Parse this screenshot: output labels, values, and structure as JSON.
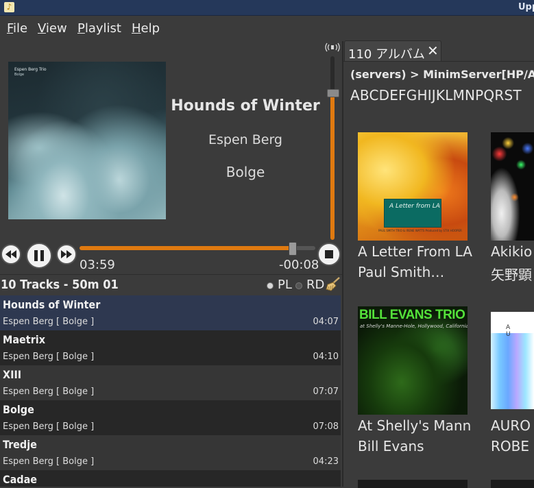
{
  "window": {
    "title": "Upp"
  },
  "menu": [
    "File",
    "View",
    "Playlist",
    "Help"
  ],
  "now_playing": {
    "title": "Hounds of Winter",
    "artist": "Espen Berg",
    "album": "Bolge",
    "cover_artist": "Espen Berg Trio",
    "cover_album": "Bolge",
    "elapsed": "03:59",
    "remaining": "-00:08",
    "progress_fraction": 0.95,
    "volume_fraction": 0.8
  },
  "playlist_header": {
    "summary": "10 Tracks - 50m 01",
    "pl_label": "PL",
    "rd_label": "RD"
  },
  "playlist": [
    {
      "title": "Hounds of Winter",
      "sub": "Espen Berg  [ Bolge ]",
      "duration": "04:07"
    },
    {
      "title": "Maetrix",
      "sub": "Espen Berg  [ Bolge ]",
      "duration": "04:10"
    },
    {
      "title": "XIII",
      "sub": "Espen Berg  [ Bolge ]",
      "duration": "07:07"
    },
    {
      "title": "Bolge",
      "sub": "Espen Berg  [ Bolge ]",
      "duration": "07:08"
    },
    {
      "title": "Tredje",
      "sub": "Espen Berg  [ Bolge ]",
      "duration": "04:23"
    },
    {
      "title": "Cadae",
      "sub": "",
      "duration": ""
    }
  ],
  "browser": {
    "tab_label": "110 アルバム",
    "tab_close": "✕",
    "breadcrumb": "(servers) > MinimServer[HP/AMD",
    "alpha_index": "ABCDEFGHIJKLMNPQRST",
    "albums": [
      {
        "name": "A Letter From LA",
        "artist": "Paul Smith…",
        "cover_plate": "A Letter from LA",
        "cover_small": "PAUL SMITH TRIO & IRENE WATTS  Produced by STIX HOOPER"
      },
      {
        "name": "Akikio",
        "artist": "矢野顕"
      },
      {
        "name": "At Shelly's Mann",
        "artist": "Bill Evans",
        "cover_title": "BILL EVANS TRIO",
        "cover_sub": "at Shelly's Manne-Hole, Hollywood, California"
      },
      {
        "name": "AURO",
        "artist": "ROBE",
        "cover_text": "A U"
      }
    ]
  },
  "colors": {
    "accent": "#e07a10",
    "selected_row": "#2e3850",
    "titlebar": "#25385a"
  }
}
